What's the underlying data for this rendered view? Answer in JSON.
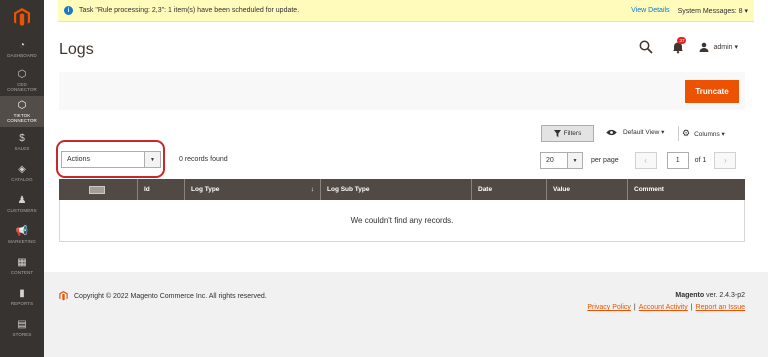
{
  "sidebar": {
    "items": [
      {
        "icon": "dashboard-icon",
        "glyph": "◔",
        "label": "DASHBOARD"
      },
      {
        "icon": "ced-connector-icon",
        "glyph": "⬡",
        "label": "CED\nCONNECTOR"
      },
      {
        "icon": "tiktok-connector-icon",
        "glyph": "⬡",
        "label": "TIKTOK\nCONNECTOR"
      },
      {
        "icon": "sales-icon",
        "glyph": "$",
        "label": "SALES"
      },
      {
        "icon": "catalog-icon",
        "glyph": "◈",
        "label": "CATALOG"
      },
      {
        "icon": "customers-icon",
        "glyph": "♟",
        "label": "CUSTOMERS"
      },
      {
        "icon": "marketing-icon",
        "glyph": "📢",
        "label": "MARKETING"
      },
      {
        "icon": "content-icon",
        "glyph": "▦",
        "label": "CONTENT"
      },
      {
        "icon": "reports-icon",
        "glyph": "▮",
        "label": "REPORTS"
      },
      {
        "icon": "stores-icon",
        "glyph": "▤",
        "label": "STORES"
      }
    ]
  },
  "message": {
    "text": "Task \"Rule processing: 2,3\": 1 item(s) have been scheduled for update.",
    "view_details": "View Details",
    "system_messages": "System Messages: 8 ▾"
  },
  "header": {
    "title": "Logs",
    "notifications_count": "37",
    "user": "admin ▾"
  },
  "toolbar": {
    "truncate_label": "Truncate",
    "filters_label": "Filters",
    "default_view_label": "Default View ▾",
    "columns_label": "Columns ▾"
  },
  "grid_controls": {
    "actions_value": "Actions",
    "records_found": "0 records found",
    "per_page_value": "20",
    "per_page_label": "per page",
    "page_value": "1",
    "of_pages": "of 1"
  },
  "grid": {
    "columns": [
      "Id",
      "Log Type",
      "Log Sub Type",
      "Date",
      "Value",
      "Comment"
    ],
    "sort_indicator": "↓",
    "empty_text": "We couldn't find any records."
  },
  "footer": {
    "copyright": "Copyright © 2022 Magento Commerce Inc. All rights reserved.",
    "brand": "Magento",
    "version": " ver. 2.4.3-p2",
    "links": [
      "Privacy Policy",
      "Account Activity",
      "Report an Issue"
    ]
  },
  "colors": {
    "accent": "#eb5202",
    "sidebar": "#373330",
    "grid_header": "#514943",
    "highlight_ring": "#c9282a"
  }
}
